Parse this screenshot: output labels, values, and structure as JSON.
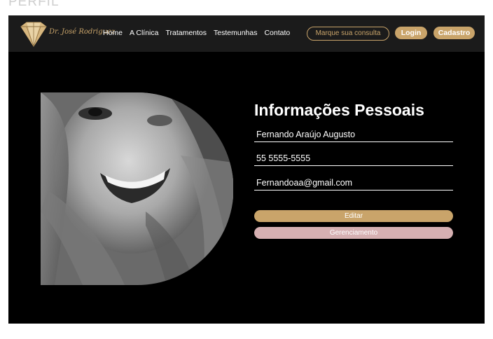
{
  "page_label": "PERFIL",
  "brand": {
    "name": "Dr. José Rodriguez",
    "accent_color": "#c9a46a",
    "logo_icon": "diamond-tooth-logo-icon"
  },
  "nav": {
    "links": [
      "Home",
      "A Clínica",
      "Tratamentos",
      "Testemunhas",
      "Contato"
    ],
    "consult_label": "Marque sua consulta",
    "login_label": "Login",
    "register_label": "Cadastro"
  },
  "profile": {
    "photo_icon": "profile-photo-smiling-woman",
    "title": "Informações Pessoais",
    "name": "Fernando Araújo Augusto",
    "phone": "55 5555-5555",
    "email": "Fernandoaa@gmail.com",
    "edit_label": "Editar",
    "manage_label": "Gerenciamento",
    "edit_color": "#c9a46a",
    "manage_color": "#d6b0b2"
  }
}
